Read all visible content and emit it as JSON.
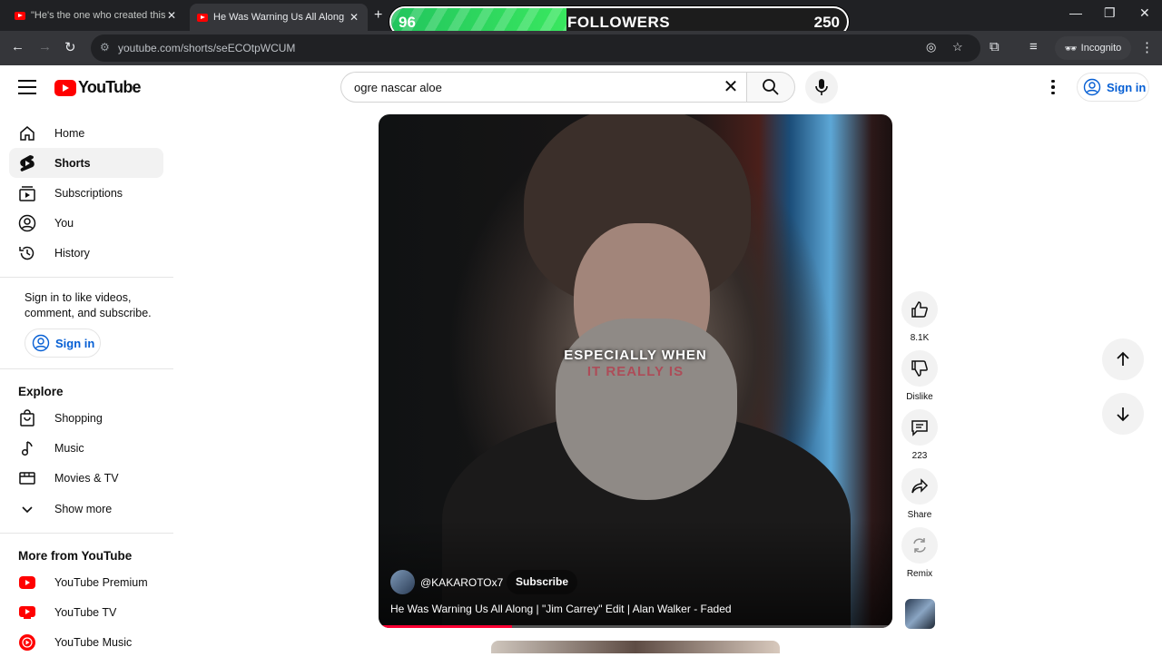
{
  "browser": {
    "tabs": [
      {
        "title": "\"He's the one who created this"
      },
      {
        "title": "He Was Warning Us All Along | "
      }
    ],
    "url": "youtube.com/shorts/seECOtpWCUM",
    "incognito_label": "Incognito"
  },
  "overlay": {
    "current": "96",
    "label": "FOLLOWERS",
    "goal": "250",
    "progress_fraction": 0.384,
    "color": "#2ad158"
  },
  "header": {
    "logo_text": "YouTube",
    "search_query": "ogre nascar aloe",
    "sign_in": "Sign in"
  },
  "sidebar": {
    "items": [
      {
        "label": "Home",
        "icon": "home-icon"
      },
      {
        "label": "Shorts",
        "icon": "shorts-icon",
        "active": true
      },
      {
        "label": "Subscriptions",
        "icon": "subscriptions-icon"
      },
      {
        "label": "You",
        "icon": "you-icon"
      },
      {
        "label": "History",
        "icon": "history-icon"
      }
    ],
    "signin_note": "Sign in to like videos, comment, and subscribe.",
    "signin_button": "Sign in",
    "explore_heading": "Explore",
    "explore": [
      {
        "label": "Shopping",
        "icon": "shopping-icon"
      },
      {
        "label": "Music",
        "icon": "music-icon"
      },
      {
        "label": "Movies & TV",
        "icon": "movies-icon"
      },
      {
        "label": "Show more",
        "icon": "chevron-down-icon"
      }
    ],
    "more_heading": "More from YouTube",
    "more": [
      {
        "label": "YouTube Premium"
      },
      {
        "label": "YouTube TV"
      },
      {
        "label": "YouTube Music"
      }
    ]
  },
  "video": {
    "caption_line1": "ESPECIALLY WHEN",
    "caption_line2": "IT REALLY IS",
    "channel": "@KAKAROTOx7",
    "subscribe": "Subscribe",
    "title": "He Was Warning Us All Along | \"Jim Carrey\" Edit | Alan Walker - Faded",
    "progress_fraction": 0.26
  },
  "actions": {
    "like_count": "8.1K",
    "dislike": "Dislike",
    "comments": "223",
    "share": "Share",
    "remix": "Remix"
  },
  "colors": {
    "brand_red": "#ff0000",
    "link_blue": "#065fd4",
    "progress_red": "#ff0033"
  }
}
